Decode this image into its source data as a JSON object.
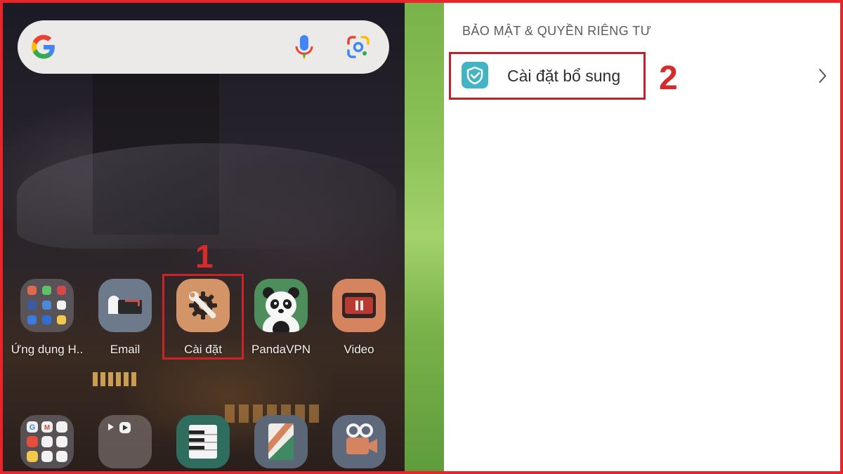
{
  "home": {
    "apps": [
      {
        "label": "Ứng dụng H..",
        "icon": "app-folder-icon"
      },
      {
        "label": "Email",
        "icon": "email-icon"
      },
      {
        "label": "Cài đặt",
        "icon": "settings-wrench-gear-icon"
      },
      {
        "label": "PandaVPN",
        "icon": "panda-icon"
      },
      {
        "label": "Video",
        "icon": "video-icon"
      }
    ],
    "dock": [
      "google-apps-folder-icon",
      "media-folder-icon",
      "piano-icon",
      "notes-icon",
      "camera-icon"
    ],
    "step_number": "1"
  },
  "settings": {
    "section_title": "BẢO MẬT & QUYỀN RIÊNG TƯ",
    "item_label": "Cài đặt bổ sung",
    "step_number": "2"
  },
  "colors": {
    "callout_red": "#d72a2a",
    "frame_red": "#e8252a",
    "shield_teal": "#44b4c2",
    "settings_tile": "#d39568",
    "video_tile": "#d6845f",
    "panda_tile": "#4d8e5c"
  }
}
